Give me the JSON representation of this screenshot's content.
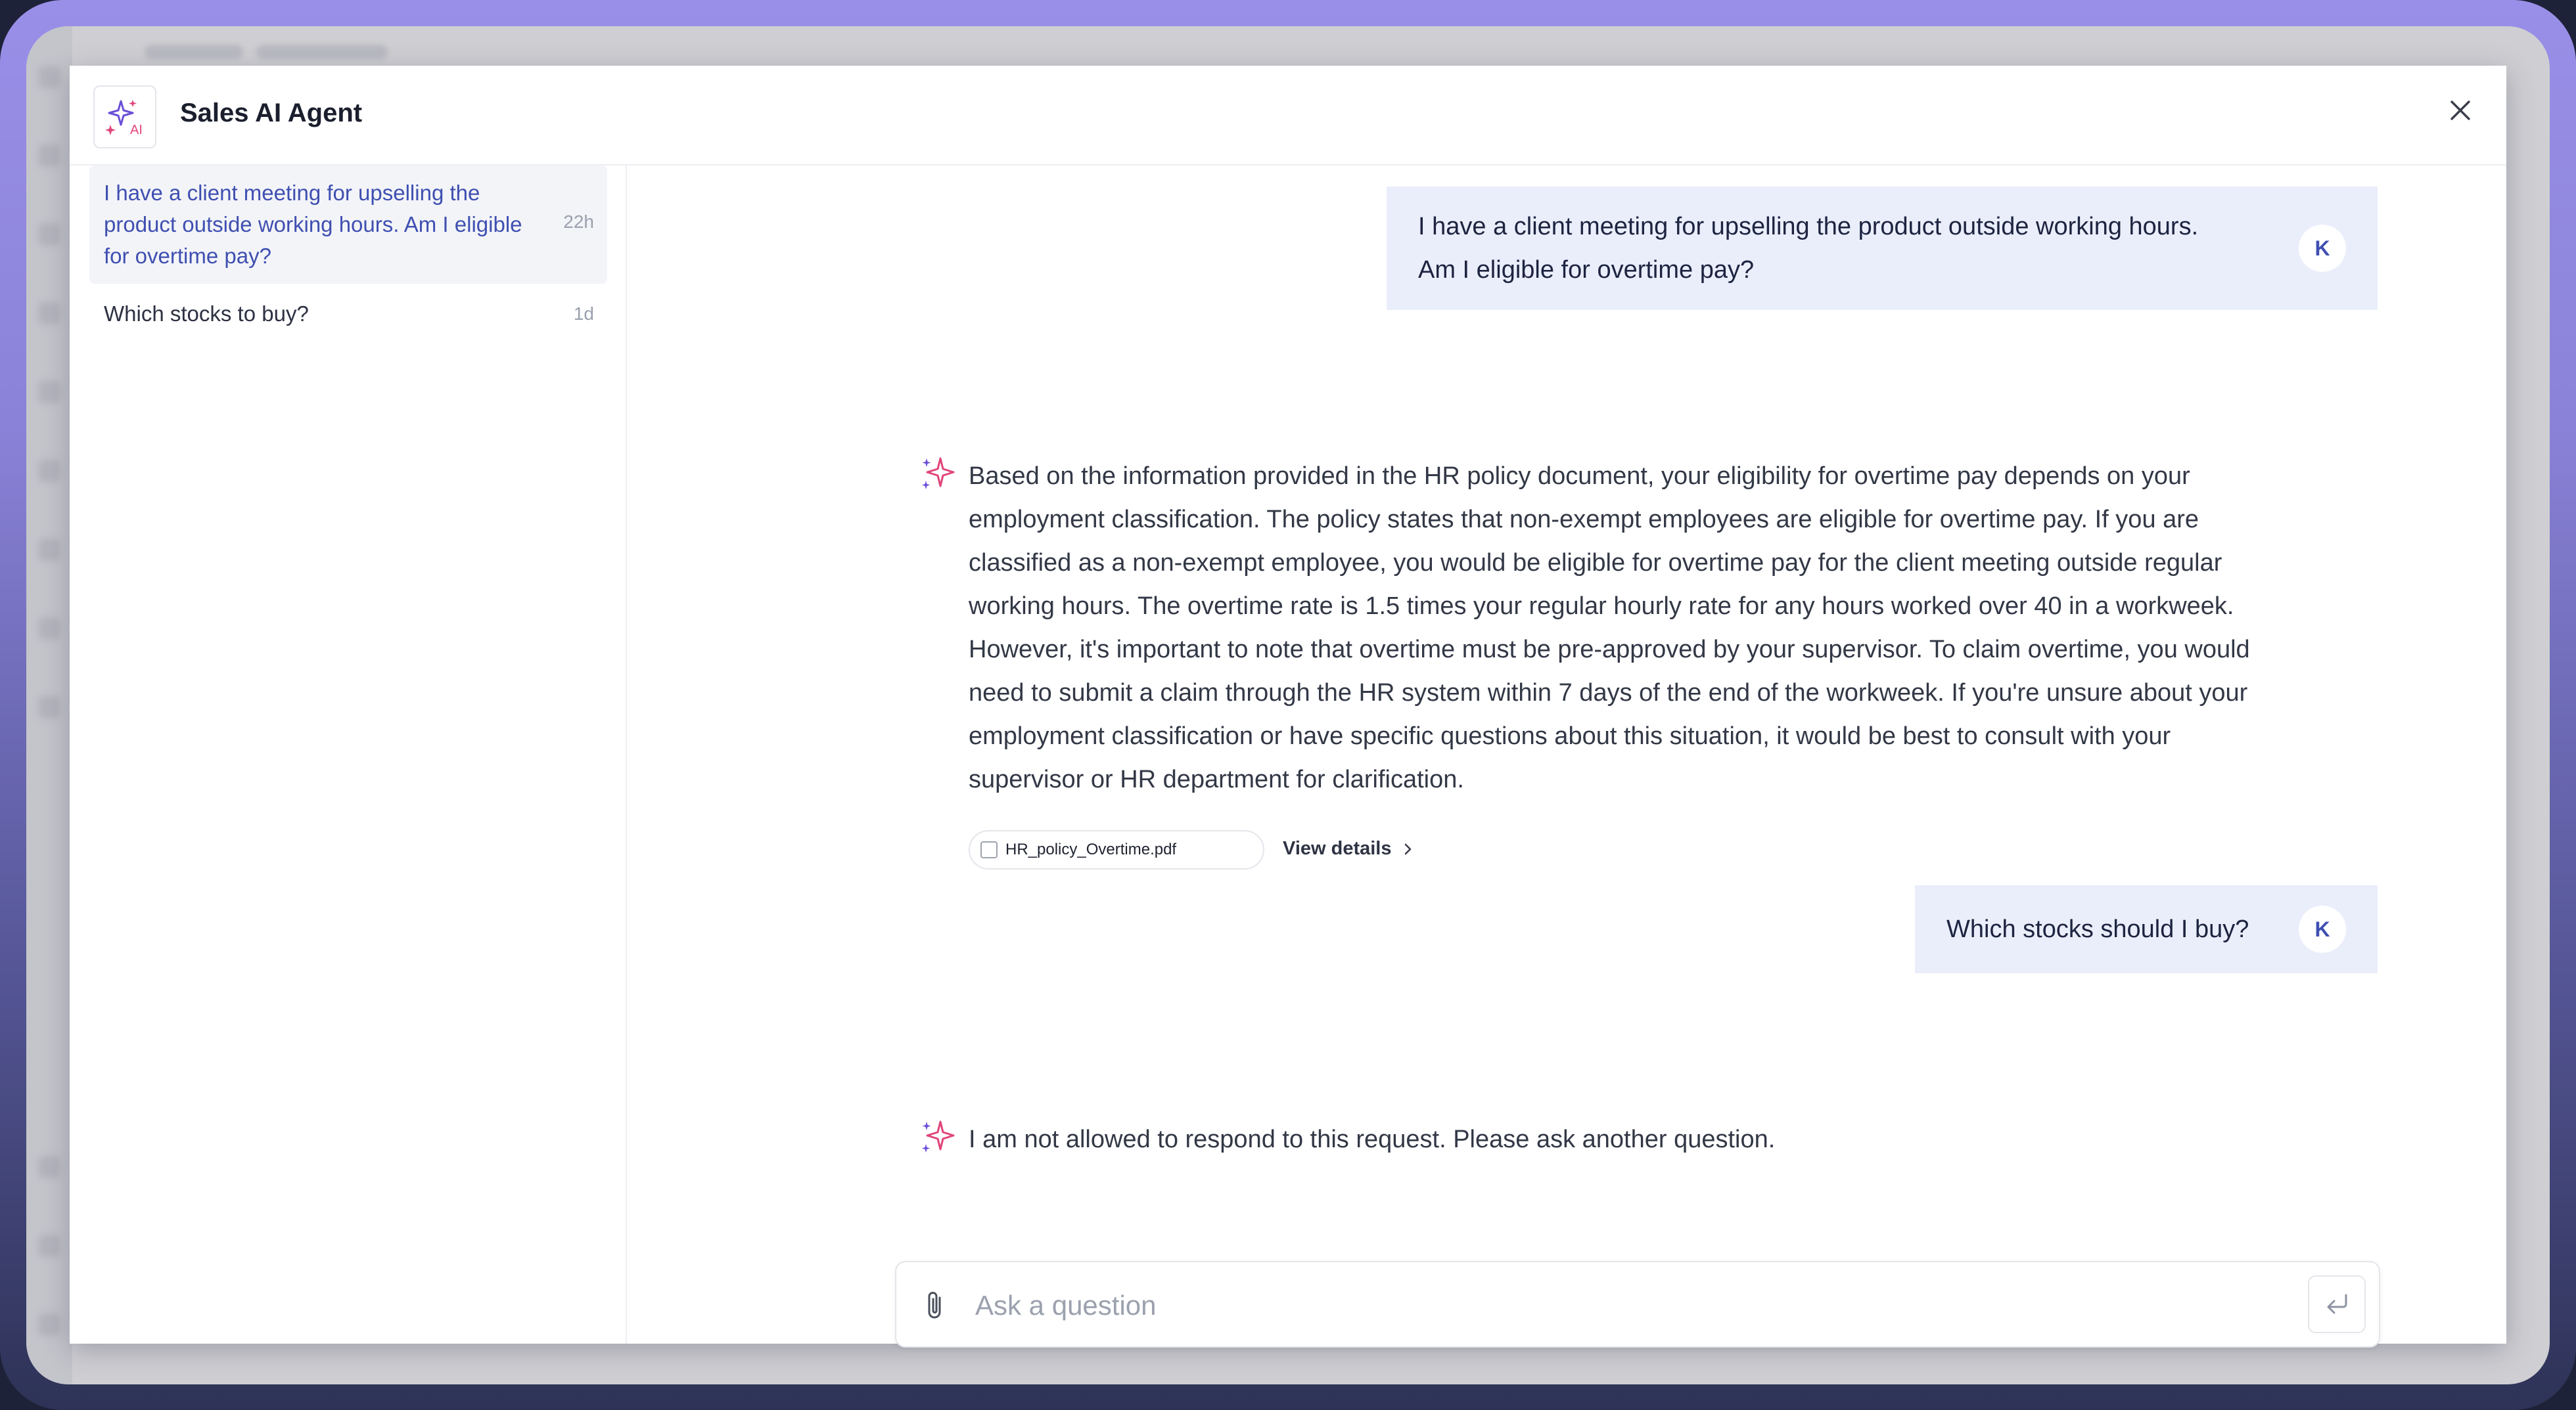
{
  "header": {
    "title": "Sales AI Agent",
    "logo_icon": "sparkles-ai-icon",
    "logo_text": "AI"
  },
  "sidebar": {
    "conversations": [
      {
        "title": "I have a client meeting for upselling the product outside working hours. Am I eligible for overtime pay?",
        "time": "22h",
        "active": true
      },
      {
        "title": "Which stocks to buy?",
        "time": "1d",
        "active": false
      }
    ]
  },
  "chat": {
    "messages": [
      {
        "role": "user",
        "avatar": "K",
        "text_lines": [
          "I have a client meeting for upselling the product outside working hours.",
          "Am I eligible for overtime pay?"
        ]
      },
      {
        "role": "assistant",
        "text_lines": [
          "Based on the information provided in the HR policy document, your eligibility for overtime pay depends on your",
          "employment classification. The policy states that non-exempt employees are eligible for overtime pay. If you are",
          "classified as a non-exempt employee, you would be eligible for overtime pay for the client meeting outside regular",
          "working hours. The overtime rate is 1.5 times your regular hourly rate for any hours worked over 40 in a workweek.",
          "However, it's important to note that overtime must be pre-approved by your supervisor. To claim overtime, you would",
          "need to submit a claim through the HR system within 7 days of the end of the workweek. If you're unsure about your",
          "employment classification or have specific questions about this situation, it would be best to consult with your",
          "supervisor or HR department for clarification."
        ],
        "attachment": "HR_policy_Overtime.pdf",
        "view_details": "View details"
      },
      {
        "role": "user",
        "avatar": "K",
        "text_lines": [
          "Which stocks should I buy?"
        ]
      },
      {
        "role": "assistant",
        "text_lines": [
          "I am not allowed to respond to this request. Please ask another question."
        ]
      }
    ]
  },
  "input": {
    "placeholder": "Ask a question",
    "value": ""
  },
  "colors": {
    "accent": "#3f4fb1",
    "user_bubble": "#eaeefb",
    "ai_icon_pink": "#e0457b",
    "ai_icon_purple": "#6b4fd8"
  }
}
